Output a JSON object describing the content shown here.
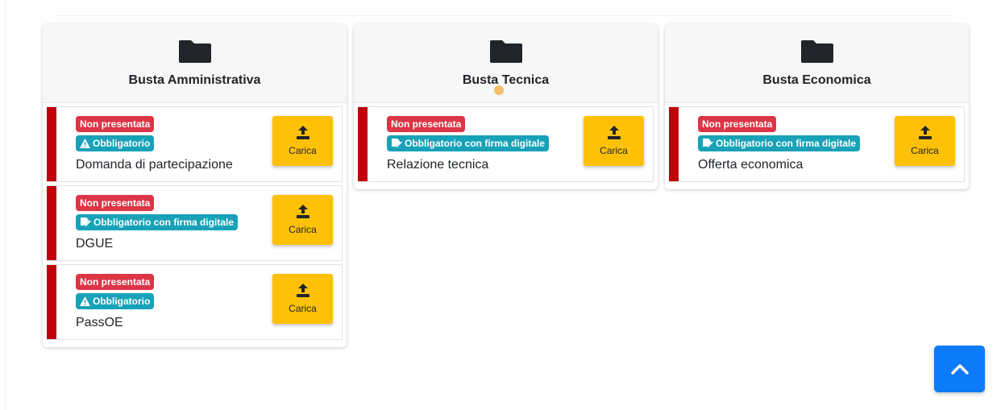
{
  "colors": {
    "status_bar": "#c0000b",
    "badge_red": "#dc3545",
    "badge_teal": "#17a2b8",
    "upload_button": "#ffc107",
    "scroll_top_button": "#0d7bf7"
  },
  "buste": [
    {
      "title": "Busta Amministrativa",
      "icon": "folder-icon",
      "documents": [
        {
          "status": "Non presentata",
          "requirement": "Obbligatorio",
          "requirement_icon": "warning-icon",
          "name": "Domanda di partecipazione",
          "button_label": "Carica"
        },
        {
          "status": "Non presentata",
          "requirement": "Obbligatorio con firma digitale",
          "requirement_icon": "signature-icon",
          "name": "DGUE",
          "button_label": "Carica"
        },
        {
          "status": "Non presentata",
          "requirement": "Obbligatorio",
          "requirement_icon": "warning-icon",
          "name": "PassOE",
          "button_label": "Carica"
        }
      ]
    },
    {
      "title": "Busta Tecnica",
      "icon": "folder-icon",
      "documents": [
        {
          "status": "Non presentata",
          "requirement": "Obbligatorio con firma digitale",
          "requirement_icon": "signature-icon",
          "name": "Relazione tecnica",
          "button_label": "Carica"
        }
      ]
    },
    {
      "title": "Busta Economica",
      "icon": "folder-icon",
      "documents": [
        {
          "status": "Non presentata",
          "requirement": "Obbligatorio con firma digitale",
          "requirement_icon": "signature-icon",
          "name": "Offerta economica",
          "button_label": "Carica"
        }
      ]
    }
  ],
  "scroll_top": {
    "icon": "chevron-up-icon"
  }
}
